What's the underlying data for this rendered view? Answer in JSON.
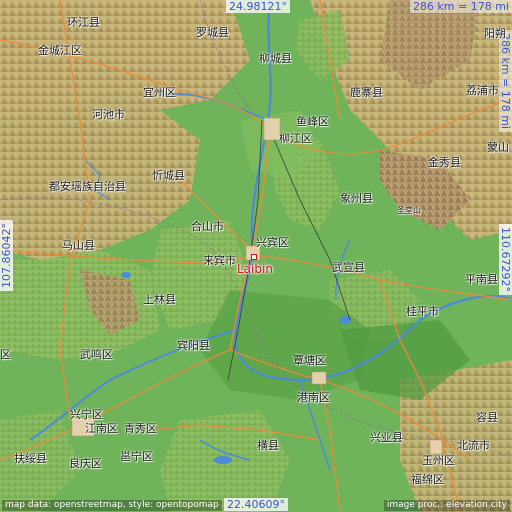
{
  "coords": {
    "top": "24.98121°",
    "bottom": "22.40609°",
    "left": "107.86042°",
    "right": "110.67292°"
  },
  "scale": {
    "top": "286 km = 178 mi",
    "right": "286 km = 178 mi"
  },
  "place": "Laibin",
  "labels": [
    "环江县",
    "罗城县",
    "金城江区",
    "柳城县",
    "宜州区",
    "鹿寨县",
    "荔浦市",
    "河池市",
    "鱼峰区",
    "柳江区",
    "蒙山",
    "金秀县",
    "忻城县",
    "都安瑶族自治县",
    "象州县",
    "合山市",
    "兴宾区",
    "马山县",
    "来宾市",
    "武宣县",
    "平南县",
    "上林县",
    "桂平市",
    "宾阳县",
    "覃塘区",
    "武鸣区",
    "港南区",
    "兴宁区",
    "江南区",
    "青秀区",
    "兴业县",
    "容县",
    "扶绥县",
    "良庆区",
    "邕宁区",
    "横县",
    "北流市",
    "玉州区",
    "福绵区",
    "阳朔",
    "圣堂山",
    "区"
  ],
  "attribution": {
    "left": "map data: openstreetmap, style: opentopomap",
    "right": "image proc.: elevation.city"
  }
}
